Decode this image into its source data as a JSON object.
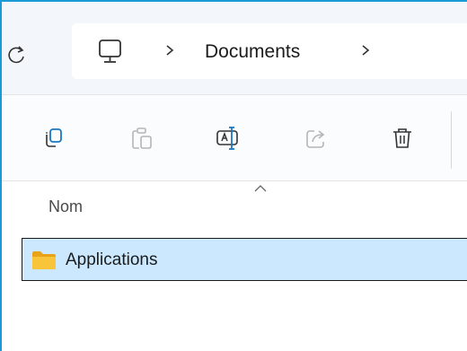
{
  "address": {
    "refresh_icon": "refresh-icon",
    "pc_icon": "pc-icon",
    "crumbs": [
      "Documents"
    ]
  },
  "toolbar": {
    "buttons": [
      {
        "icon": "copy-icon",
        "enabled": true
      },
      {
        "icon": "paste-icon",
        "enabled": false
      },
      {
        "icon": "rename-icon",
        "enabled": true
      },
      {
        "icon": "share-icon",
        "enabled": false
      },
      {
        "icon": "delete-icon",
        "enabled": true
      }
    ]
  },
  "list": {
    "column_name": "Nom",
    "sort": "ascending",
    "items": [
      {
        "label": "Applications",
        "icon": "folder-icon",
        "selected": true
      }
    ]
  },
  "colors": {
    "accent": "#1a9ad6",
    "selection": "#cce8ff",
    "folder": "#f8c43a"
  }
}
